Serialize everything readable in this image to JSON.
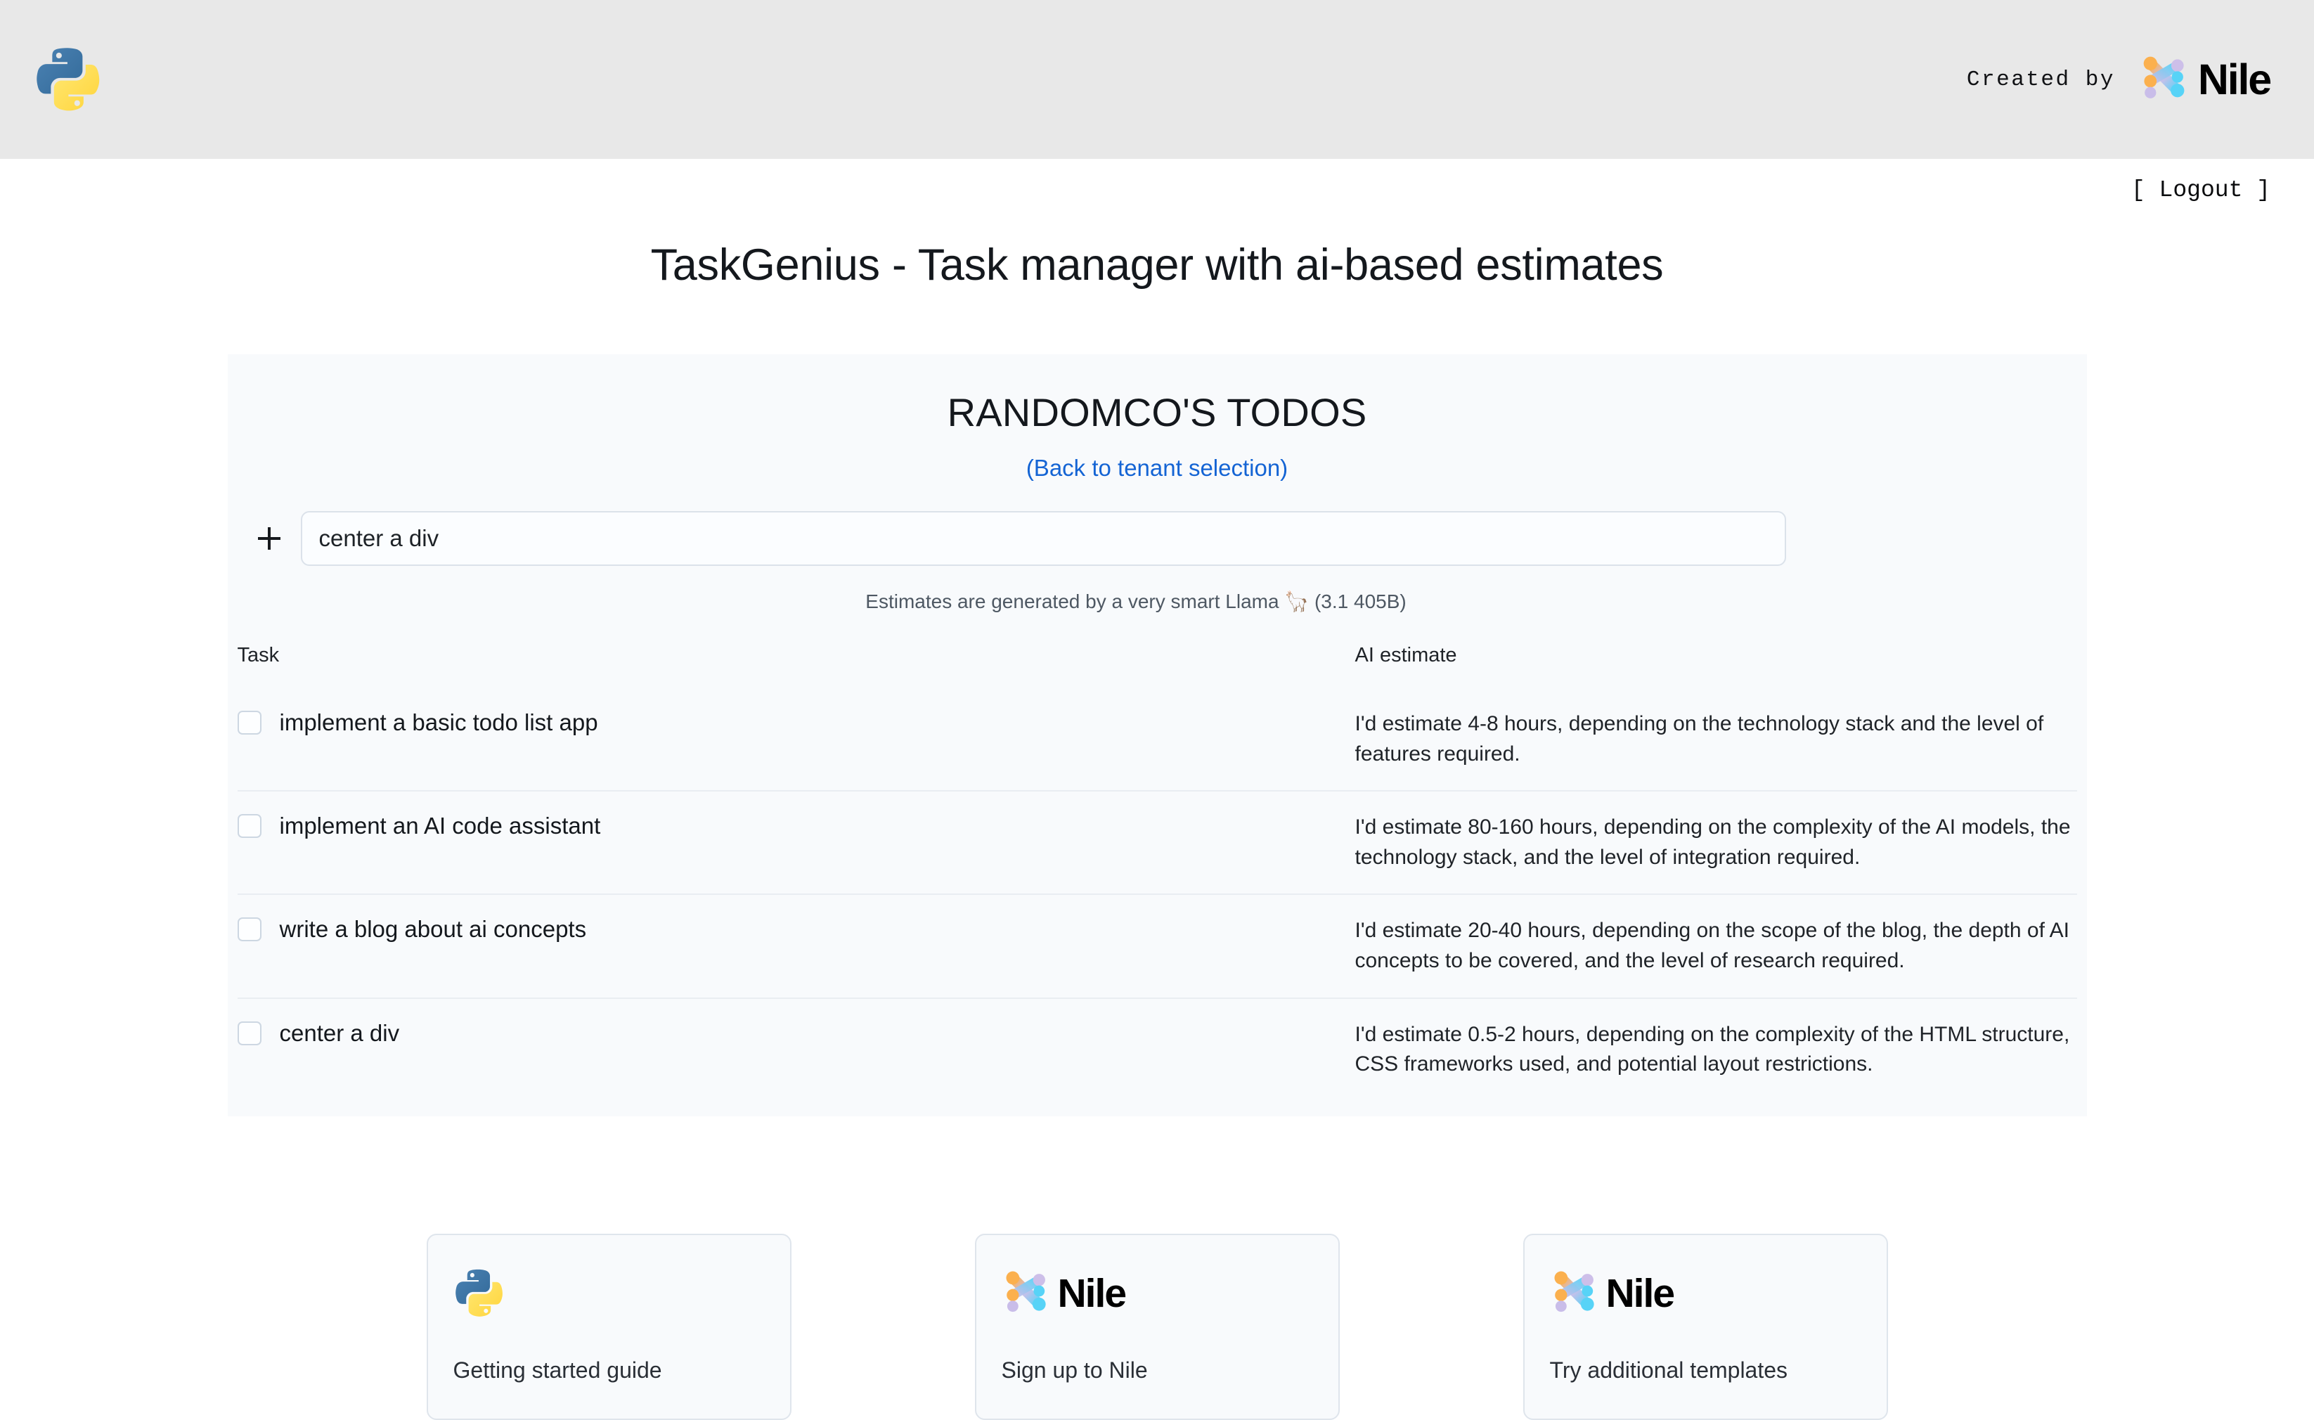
{
  "header": {
    "python_logo_alt": "python-logo",
    "created_by_label": "Created by",
    "brand_name": "Nile"
  },
  "account": {
    "logout_label": "[ Logout ]"
  },
  "page": {
    "title": "TaskGenius - Task manager with ai-based estimates"
  },
  "todo_card": {
    "title": "RANDOMCO'S TODOS",
    "back_link_label": "(Back to tenant selection)",
    "add_icon": "plus-icon",
    "new_task_value": "center a div",
    "new_task_placeholder": "",
    "llama_note": "Estimates are generated by a very smart Llama 🦙 (3.1 405B)",
    "columns": [
      "Task",
      "AI estimate"
    ],
    "rows": [
      {
        "checked": false,
        "task": "implement a basic todo list app",
        "estimate": "I'd estimate 4-8 hours, depending on the technology stack and the level of features required."
      },
      {
        "checked": false,
        "task": "implement an AI code assistant",
        "estimate": "I'd estimate 80-160 hours, depending on the complexity of the AI models, the technology stack, and the level of integration required."
      },
      {
        "checked": false,
        "task": "write a blog about ai concepts",
        "estimate": "I'd estimate 20-40 hours, depending on the scope of the blog, the depth of AI concepts to be covered, and the level of research required."
      },
      {
        "checked": false,
        "task": "center a div",
        "estimate": "I'd estimate 0.5-2 hours, depending on the complexity of the HTML structure, CSS frameworks used, and potential layout restrictions."
      }
    ]
  },
  "footer_cards": [
    {
      "logo": "python-logo",
      "label": "Getting started guide"
    },
    {
      "logo": "nile-logo",
      "brand": "Nile",
      "label": "Sign up to Nile"
    },
    {
      "logo": "nile-logo",
      "brand": "Nile",
      "label": "Try additional templates"
    }
  ],
  "colors": {
    "topbar_bg": "#e8e8e8",
    "card_bg": "#f8fafc",
    "link_blue": "#1464d4",
    "python_blue": "#3a6fa0",
    "python_yellow": "#ffda4b",
    "nile_orange": "#f9b05a",
    "nile_purple": "#c3b6e8",
    "nile_cyan": "#62d4f5"
  }
}
